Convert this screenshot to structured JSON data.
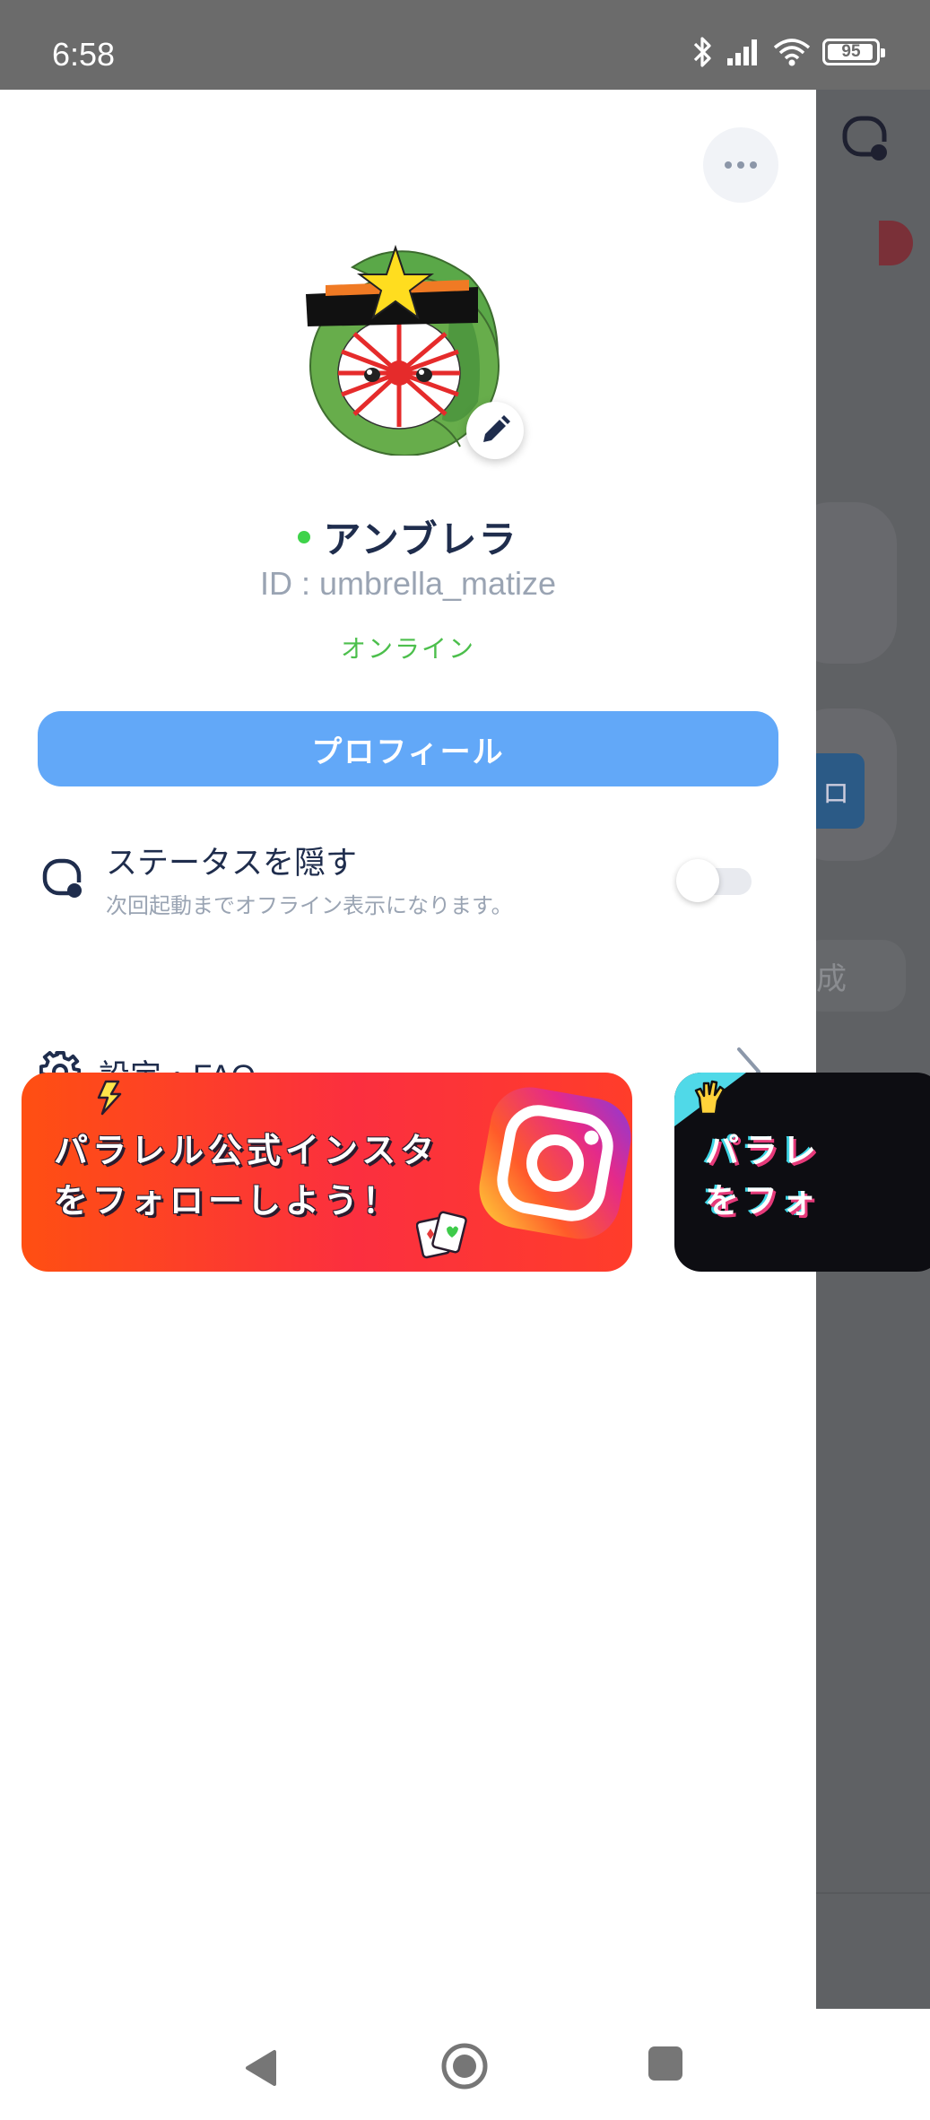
{
  "status_bar": {
    "time": "6:58",
    "battery": "95",
    "battery_level_percent": 95
  },
  "drawer": {
    "profile": {
      "display_name": "アンブレラ",
      "user_id": "ID : umbrella_matize",
      "status": "オンライン"
    },
    "profile_button_label": "プロフィール",
    "hide_status": {
      "title": "ステータスを隠す",
      "description": "次回起動までオフライン表示になります。",
      "enabled": false
    },
    "settings_label": "設定・FAQ",
    "banners": [
      {
        "text": "パラレル公式インスタ\nをフォローしよう！"
      },
      {
        "text": "パラレ\nをフォ"
      }
    ]
  },
  "background": {
    "button_label": "ロ",
    "pill_label": "成"
  },
  "colors": {
    "accent_blue": "#62a8f8",
    "online_green": "#4cbf4c",
    "title_navy": "#1f2d4d",
    "muted_gray": "#9aa4b3"
  }
}
